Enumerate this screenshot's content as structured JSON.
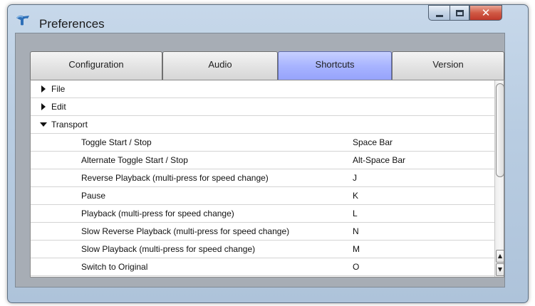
{
  "window": {
    "title": "Preferences",
    "close_glyph": "✕"
  },
  "tabs": [
    {
      "label": "Configuration",
      "active": false
    },
    {
      "label": "Audio",
      "active": false
    },
    {
      "label": "Shortcuts",
      "active": true
    },
    {
      "label": "Version",
      "active": false
    }
  ],
  "tree": {
    "groups": [
      {
        "label": "File",
        "expanded": false
      },
      {
        "label": "Edit",
        "expanded": false
      },
      {
        "label": "Transport",
        "expanded": true
      }
    ],
    "shortcuts": [
      {
        "action": "Toggle Start / Stop",
        "key": "Space Bar"
      },
      {
        "action": "Alternate Toggle Start / Stop",
        "key": "Alt-Space Bar"
      },
      {
        "action": "Reverse Playback (multi-press for speed change)",
        "key": "J"
      },
      {
        "action": "Pause",
        "key": "K"
      },
      {
        "action": "Playback (multi-press for speed change)",
        "key": "L"
      },
      {
        "action": "Slow Reverse Playback (multi-press for speed change)",
        "key": "N"
      },
      {
        "action": "Slow Playback (multi-press for speed change)",
        "key": "M"
      },
      {
        "action": "Switch to Original",
        "key": "O"
      }
    ]
  },
  "scrollbar": {
    "up_glyph": "▲",
    "down_glyph": "▼"
  },
  "colors": {
    "active_tab": "#a8b4ff",
    "close_button": "#c0392b",
    "titlebar": "#c7d8ea"
  }
}
